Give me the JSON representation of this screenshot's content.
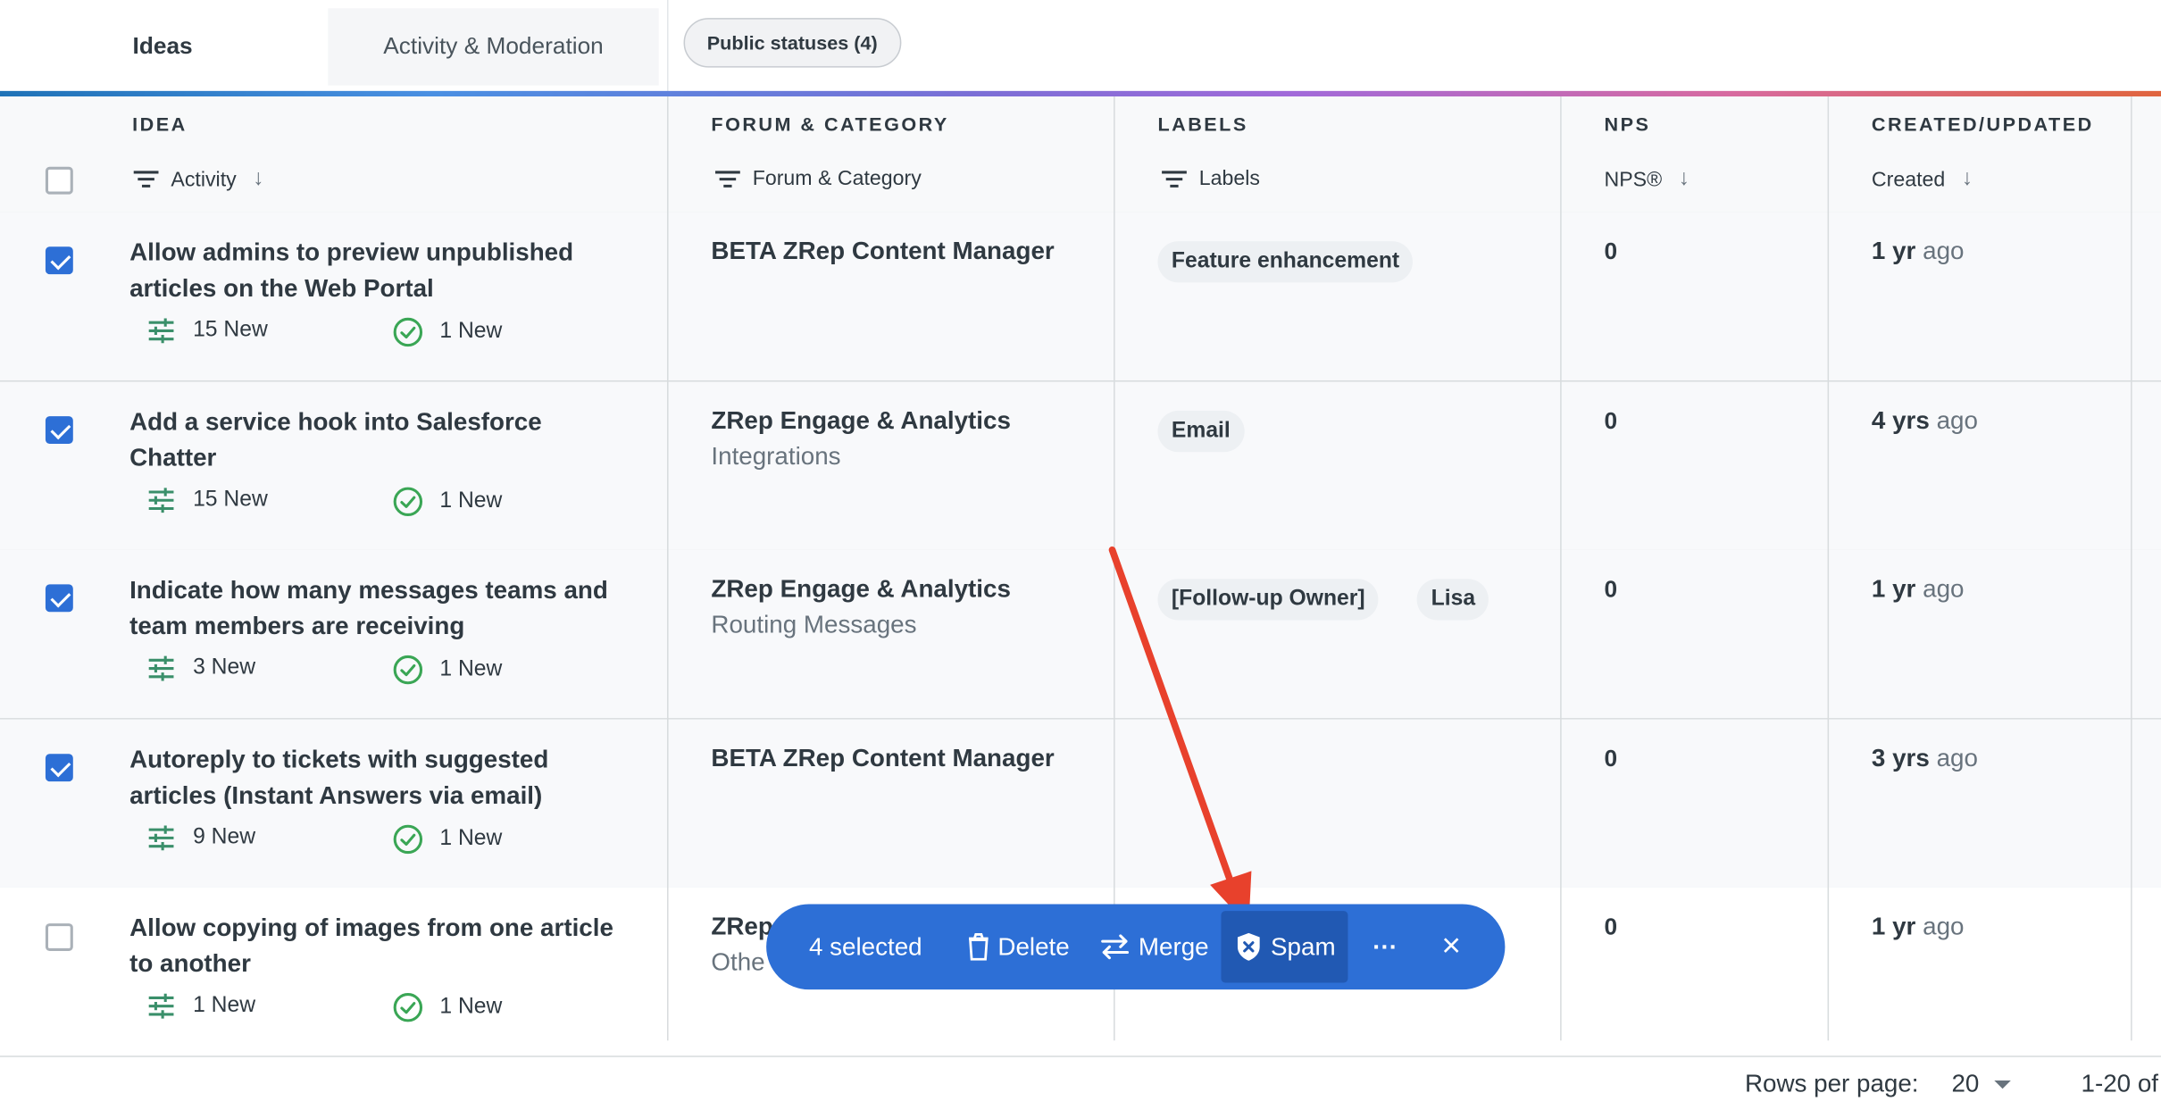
{
  "tabs": [
    {
      "label": "Ideas"
    },
    {
      "label": "Activity & Moderation"
    }
  ],
  "public_statuses": "Public statuses (4)",
  "columns": {
    "idea": {
      "title": "IDEA",
      "sub": "Activity"
    },
    "forum": {
      "title": "FORUM & CATEGORY",
      "sub": "Forum & Category"
    },
    "labels": {
      "title": "LABELS",
      "sub": "Labels"
    },
    "nps": {
      "title": "NPS",
      "sub": "NPS®"
    },
    "created": {
      "title": "CREATED/UPDATED",
      "sub": "Created"
    }
  },
  "rows": [
    {
      "checked": true,
      "title": "Allow admins to preview unpublished articles on the Web Portal",
      "activity": "15 New",
      "moderation": "1 New",
      "forum": "BETA ZRep Content Manager",
      "category": "",
      "labels": [
        "Feature enhancement"
      ],
      "nps": "0",
      "created_num": "1 yr",
      "created_suffix": "ago"
    },
    {
      "checked": true,
      "title": "Add a service hook into Salesforce Chatter",
      "activity": "15 New",
      "moderation": "1 New",
      "forum": "ZRep Engage & Analytics",
      "category": "Integrations",
      "labels": [
        "Email"
      ],
      "nps": "0",
      "created_num": "4 yrs",
      "created_suffix": "ago"
    },
    {
      "checked": true,
      "title": "Indicate how many messages teams and team members are receiving",
      "activity": "3 New",
      "moderation": "1 New",
      "forum": "ZRep Engage & Analytics",
      "category": "Routing Messages",
      "labels": [
        "[Follow-up Owner]",
        "Lisa"
      ],
      "nps": "0",
      "created_num": "1 yr",
      "created_suffix": "ago"
    },
    {
      "checked": true,
      "title": "Autoreply to tickets with suggested articles (Instant Answers via email)",
      "activity": "9 New",
      "moderation": "1 New",
      "forum": "BETA ZRep Content Manager",
      "category": "",
      "labels": [],
      "nps": "0",
      "created_num": "3 yrs",
      "created_suffix": "ago"
    },
    {
      "checked": false,
      "title": "Allow copying of images from one article to another",
      "activity": "1 New",
      "moderation": "1 New",
      "forum": "ZRep",
      "category": "Othe",
      "labels": [],
      "nps": "0",
      "created_num": "1 yr",
      "created_suffix": "ago"
    }
  ],
  "bulk_bar": {
    "selected": "4 selected",
    "delete": "Delete",
    "merge": "Merge",
    "spam": "Spam",
    "more": "···",
    "close": "×"
  },
  "footer": {
    "rows_per_page_label": "Rows per page:",
    "rows_per_page_value": "20",
    "range": "1-20 of"
  },
  "colors": {
    "accent": "#2d6fd6",
    "arrow": "#e8412c",
    "check_green": "#3aa655"
  }
}
